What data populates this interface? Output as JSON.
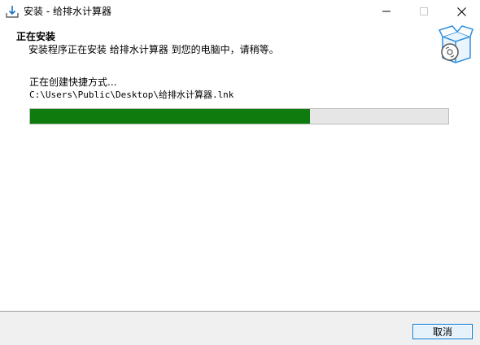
{
  "window": {
    "title": "安装 - 给排水计算器",
    "icons": {
      "app": "installer-download-icon",
      "minimize": "minimize-icon",
      "maximize": "maximize-icon",
      "close": "close-icon"
    }
  },
  "header": {
    "title": "正在安装",
    "subtitle": "安装程序正在安装 给排水计算器 到您的电脑中，请稍等。",
    "image_icon": "box-cd-icon"
  },
  "content": {
    "status": "正在创建快捷方式...",
    "detail": "C:\\Users\\Public\\Desktop\\给排水计算器.lnk",
    "progress_fraction": 0.67
  },
  "footer": {
    "cancel_label": "取消"
  },
  "colors": {
    "progress_fill": "#0f7b0f",
    "progress_track": "#e6e6e6",
    "button_accent": "#0078d7"
  }
}
